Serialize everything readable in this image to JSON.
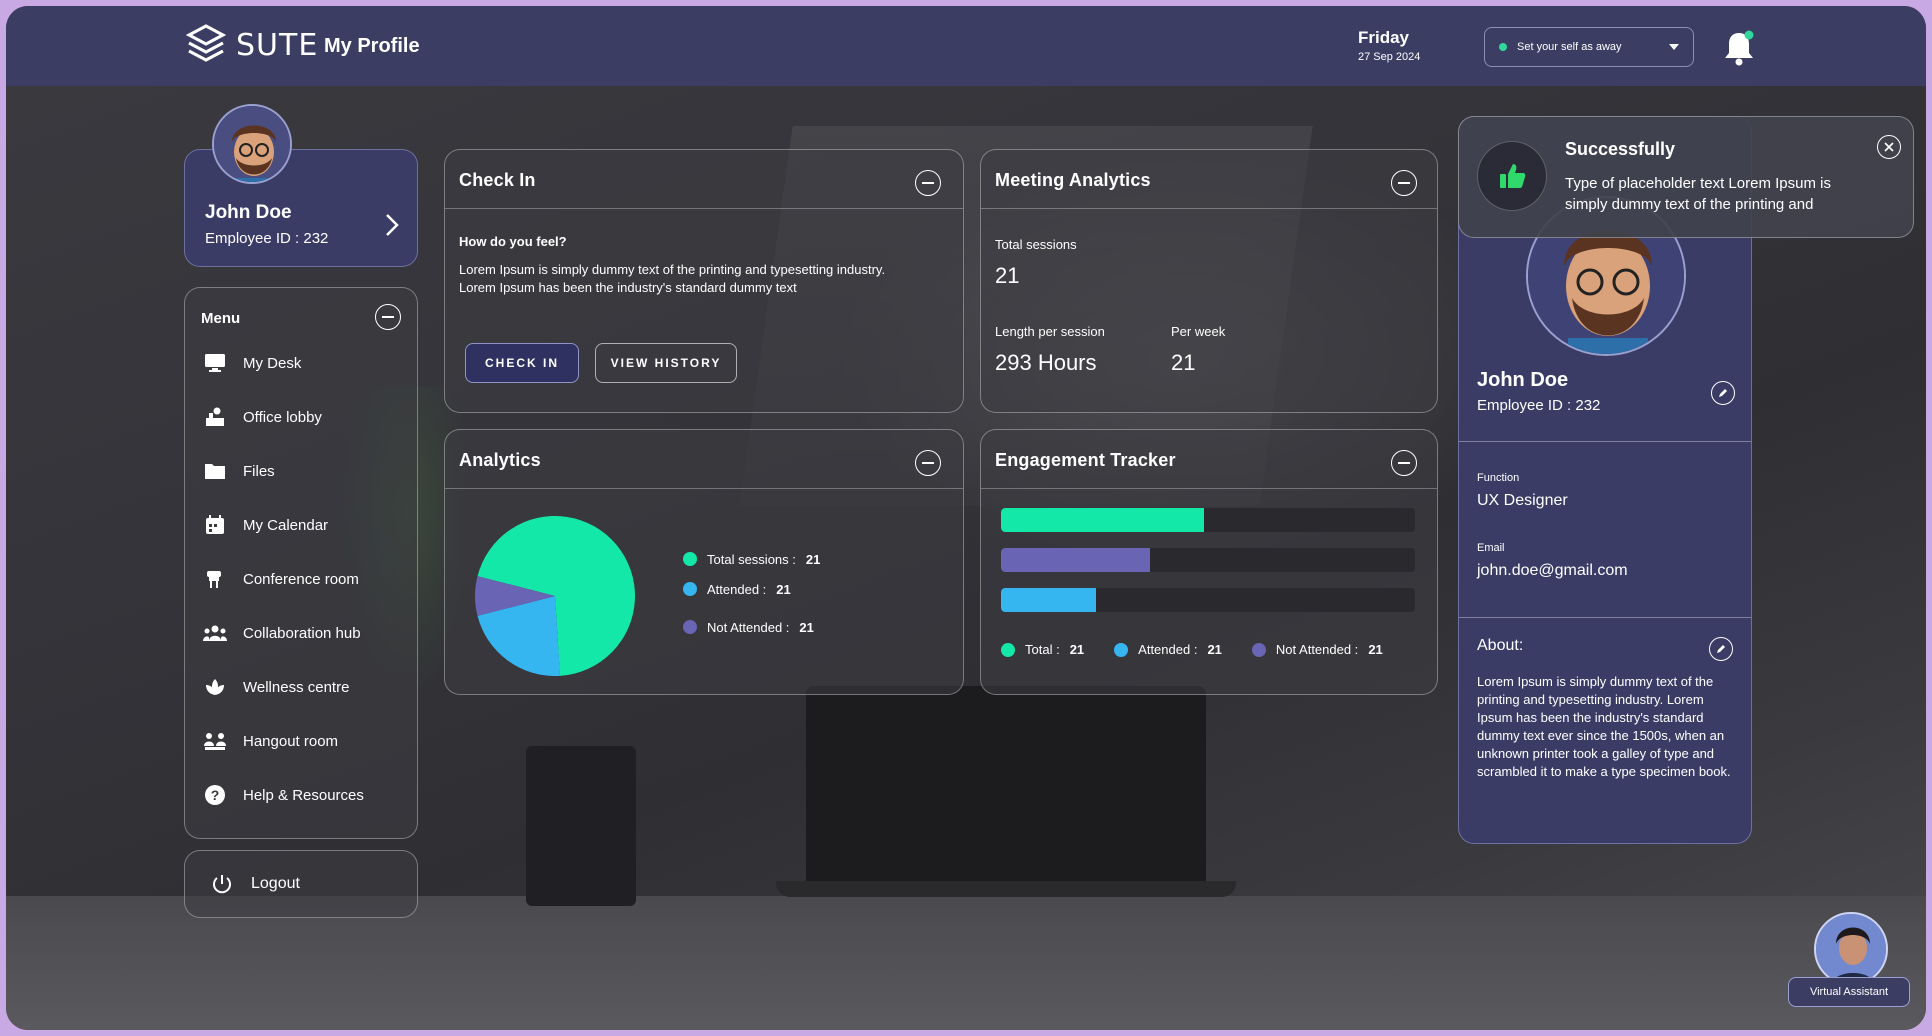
{
  "header": {
    "logo_text": "SUTE",
    "page_title": "My Profile",
    "date_day": "Friday",
    "date_full": "27 Sep 2024",
    "status_select": "Set your self as away"
  },
  "profile_mini": {
    "name": "John Doe",
    "employee_id": "Employee ID : 232"
  },
  "menu": {
    "title": "Menu",
    "items": [
      {
        "label": "My Desk",
        "icon": "monitor-icon"
      },
      {
        "label": "Office lobby",
        "icon": "lobby-icon"
      },
      {
        "label": "Files",
        "icon": "folder-icon"
      },
      {
        "label": "My Calendar",
        "icon": "calendar-icon"
      },
      {
        "label": "Conference room",
        "icon": "conference-icon"
      },
      {
        "label": "Collaboration hub",
        "icon": "group-icon"
      },
      {
        "label": "Wellness centre",
        "icon": "lotus-icon"
      },
      {
        "label": "Hangout room",
        "icon": "hangout-icon"
      },
      {
        "label": "Help & Resources",
        "icon": "help-icon"
      }
    ],
    "logout": "Logout"
  },
  "checkin": {
    "title": "Check In",
    "question": "How do you feel?",
    "text": "Lorem Ipsum is simply dummy text of the printing and typesetting industry. Lorem Ipsum has been the industry's standard dummy text",
    "btn_checkin": "CHECK IN",
    "btn_history": "VIEW HISTORY"
  },
  "meeting": {
    "title": "Meeting Analytics",
    "total_label": "Total sessions",
    "total_value": "21",
    "length_label": "Length per session",
    "length_value": "293 Hours",
    "week_label": "Per week",
    "week_value": "21"
  },
  "analytics": {
    "title": "Analytics",
    "legend": [
      {
        "label": "Total sessions : ",
        "value": "21",
        "color": "#14e8a8"
      },
      {
        "label": "Attended  : ",
        "value": "21",
        "color": "#35b6f0"
      },
      {
        "label": "Not Attended  : ",
        "value": "21",
        "color": "#6a64b4"
      }
    ]
  },
  "chart_data": {
    "type": "pie",
    "categories": [
      "Total sessions",
      "Attended",
      "Not Attended"
    ],
    "values": [
      70,
      22,
      8
    ],
    "colors": [
      "#14e8a8",
      "#35b6f0",
      "#6a64b4"
    ]
  },
  "engagement": {
    "title": "Engagement Tracker",
    "bars": [
      {
        "fraction": 0.49,
        "color": "#14e8a8"
      },
      {
        "fraction": 0.36,
        "color": "#6a64b4"
      },
      {
        "fraction": 0.23,
        "color": "#35b6f0"
      }
    ],
    "legend": [
      {
        "label": "Total  : ",
        "value": "21",
        "color": "#14e8a8"
      },
      {
        "label": "Attended  : ",
        "value": "21",
        "color": "#35b6f0"
      },
      {
        "label": "Not Attended  : ",
        "value": "21",
        "color": "#6a64b4"
      }
    ]
  },
  "profile": {
    "name": "John Doe",
    "employee_id": "Employee ID : 232",
    "function_label": "Function",
    "function_value": "UX Designer",
    "email_label": "Email",
    "email_value": "john.doe@gmail.com",
    "about_label": "About:",
    "about_text": "Lorem Ipsum is simply dummy text of the printing and typesetting industry. Lorem Ipsum has been the industry's standard dummy text ever since the 1500s, when an unknown printer took a galley of type and scrambled it to make a type specimen book."
  },
  "toast": {
    "title": "Successfully",
    "text": "Type of placeholder text Lorem Ipsum is simply dummy text of the printing and"
  },
  "assistant": {
    "label": "Virtual Assistant"
  }
}
